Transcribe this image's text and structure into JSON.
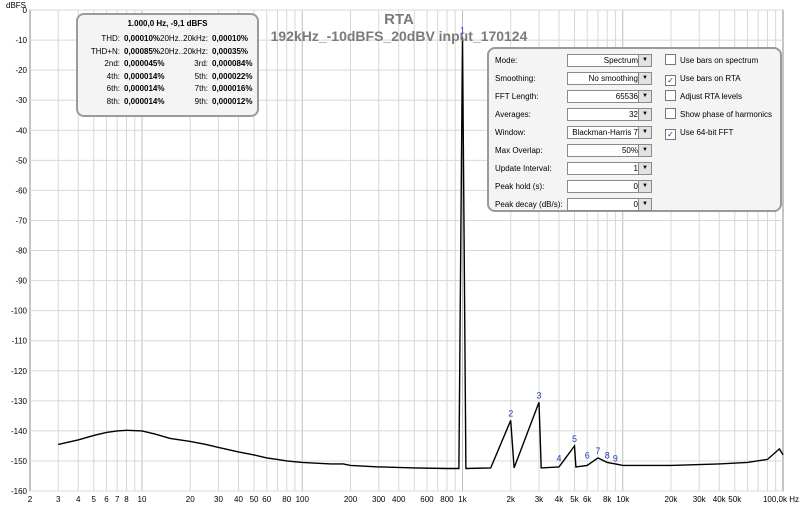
{
  "chart_data": {
    "type": "line",
    "title": "RTA",
    "subtitle": "192kHz_-10dBFS_20dBV input_170124",
    "ylabel": "dBFS",
    "x_unit": "Hz",
    "x_scale": "log",
    "xlim": [
      2,
      100000
    ],
    "ylim": [
      -160,
      0
    ],
    "grid": true,
    "y_ticks": [
      0,
      -10,
      -20,
      -30,
      -40,
      -50,
      -60,
      -70,
      -80,
      -90,
      -100,
      -110,
      -120,
      -130,
      -140,
      -150,
      -160
    ],
    "x_ticks": [
      {
        "v": 2,
        "label": "2"
      },
      {
        "v": 3,
        "label": "3"
      },
      {
        "v": 4,
        "label": "4"
      },
      {
        "v": 5,
        "label": "5"
      },
      {
        "v": 6,
        "label": "6"
      },
      {
        "v": 7,
        "label": "7"
      },
      {
        "v": 8,
        "label": "8"
      },
      {
        "v": 10,
        "label": "10"
      },
      {
        "v": 20,
        "label": "20"
      },
      {
        "v": 30,
        "label": "30"
      },
      {
        "v": 40,
        "label": "40"
      },
      {
        "v": 50,
        "label": "50"
      },
      {
        "v": 60,
        "label": "60"
      },
      {
        "v": 80,
        "label": "80"
      },
      {
        "v": 100,
        "label": "100"
      },
      {
        "v": 200,
        "label": "200"
      },
      {
        "v": 300,
        "label": "300"
      },
      {
        "v": 400,
        "label": "400"
      },
      {
        "v": 600,
        "label": "600"
      },
      {
        "v": 800,
        "label": "800"
      },
      {
        "v": 1000,
        "label": "1k"
      },
      {
        "v": 2000,
        "label": "2k"
      },
      {
        "v": 3000,
        "label": "3k"
      },
      {
        "v": 4000,
        "label": "4k"
      },
      {
        "v": 5000,
        "label": "5k"
      },
      {
        "v": 6000,
        "label": "6k"
      },
      {
        "v": 8000,
        "label": "8k"
      },
      {
        "v": 10000,
        "label": "10k"
      },
      {
        "v": 20000,
        "label": "20k"
      },
      {
        "v": 30000,
        "label": "30k"
      },
      {
        "v": 40000,
        "label": "40k"
      },
      {
        "v": 50000,
        "label": "50k"
      },
      {
        "v": 100000,
        "label": "100,0k Hz"
      }
    ],
    "series": [
      {
        "color": "#000000",
        "points": [
          [
            3,
            -144.5
          ],
          [
            4,
            -143
          ],
          [
            5,
            -141.5
          ],
          [
            6,
            -140.5
          ],
          [
            7,
            -140
          ],
          [
            8,
            -139.8
          ],
          [
            10,
            -140
          ],
          [
            12,
            -141
          ],
          [
            15,
            -142.5
          ],
          [
            20,
            -143.5
          ],
          [
            25,
            -144.5
          ],
          [
            30,
            -145.5
          ],
          [
            40,
            -147
          ],
          [
            50,
            -148
          ],
          [
            60,
            -149
          ],
          [
            70,
            -149.5
          ],
          [
            80,
            -150
          ],
          [
            100,
            -150.5
          ],
          [
            150,
            -151
          ],
          [
            180,
            -151
          ],
          [
            200,
            -151.5
          ],
          [
            300,
            -152
          ],
          [
            500,
            -152.3
          ],
          [
            800,
            -152.5
          ],
          [
            950,
            -152.5
          ],
          [
            1000,
            -9.1
          ],
          [
            1050,
            -152.5
          ],
          [
            1500,
            -152.3
          ],
          [
            2000,
            -136.5
          ],
          [
            2100,
            -152.3
          ],
          [
            3000,
            -130.5
          ],
          [
            3100,
            -152.3
          ],
          [
            4000,
            -152
          ],
          [
            5000,
            -145
          ],
          [
            5100,
            -152
          ],
          [
            6000,
            -151.5
          ],
          [
            7000,
            -149
          ],
          [
            8000,
            -150.5
          ],
          [
            9000,
            -151
          ],
          [
            10000,
            -151.5
          ],
          [
            20000,
            -151.5
          ],
          [
            40000,
            -151
          ],
          [
            60000,
            -150.5
          ],
          [
            80000,
            -149.5
          ],
          [
            95000,
            -146
          ],
          [
            100000,
            -148
          ]
        ]
      }
    ],
    "annotations": [
      {
        "label": "1",
        "x": 1000,
        "y": -9.1
      },
      {
        "label": "2",
        "x": 2000,
        "y": -136.5
      },
      {
        "label": "3",
        "x": 3000,
        "y": -130.5
      },
      {
        "label": "4",
        "x": 4000,
        "y": -151.5
      },
      {
        "label": "5",
        "x": 5000,
        "y": -145
      },
      {
        "label": "6",
        "x": 6000,
        "y": -150.5
      },
      {
        "label": "7",
        "x": 7000,
        "y": -149
      },
      {
        "label": "8",
        "x": 8000,
        "y": -150.5
      },
      {
        "label": "9",
        "x": 9000,
        "y": -151.5
      }
    ]
  },
  "distortion": {
    "header": "1.000,0 Hz, -9,1 dBFS",
    "rows": [
      {
        "l1": "THD:",
        "v1": "0,00010%",
        "l2": "20Hz..20kHz:",
        "v2": "0,00010%"
      },
      {
        "l1": "THD+N:",
        "v1": "0,00085%",
        "l2": "20Hz..20kHz:",
        "v2": "0,00035%"
      },
      {
        "l1": "2nd:",
        "v1": "0,000045%",
        "l2": "3rd:",
        "v2": "0,000084%"
      },
      {
        "l1": "4th:",
        "v1": "0,000014%",
        "l2": "5th:",
        "v2": "0,000022%"
      },
      {
        "l1": "6th:",
        "v1": "0,000014%",
        "l2": "7th:",
        "v2": "0,000016%"
      },
      {
        "l1": "8th:",
        "v1": "0,000014%",
        "l2": "9th:",
        "v2": "0,000012%"
      }
    ]
  },
  "controls": {
    "rows": [
      {
        "label": "Mode:",
        "value": "Spectrum"
      },
      {
        "label": "Smoothing:",
        "value": "No smoothing"
      },
      {
        "label": "FFT Length:",
        "value": "65536"
      },
      {
        "label": "Averages:",
        "value": "32"
      },
      {
        "label": "Window:",
        "value": "Blackman-Harris 7"
      },
      {
        "label": "Max Overlap:",
        "value": "50%"
      },
      {
        "label": "Update Interval:",
        "value": "1"
      },
      {
        "label": "Peak hold (s):",
        "value": "0"
      },
      {
        "label": "Peak decay (dB/s):",
        "value": "0"
      }
    ],
    "checkboxes": [
      {
        "label": "Use bars on spectrum",
        "checked": false
      },
      {
        "label": "Use bars on RTA",
        "checked": true
      },
      {
        "label": "Adjust RTA levels",
        "checked": false
      },
      {
        "label": "Show phase of harmonics",
        "checked": false
      },
      {
        "label": "Use 64-bit FFT",
        "checked": true
      }
    ]
  },
  "colors": {
    "trace": "#000000",
    "peak_label": "#1f3fbf",
    "grid": "#d8d8d8",
    "title": "#7a7a7a"
  },
  "icons": {
    "dropdown": "chevron-down-icon",
    "check": "checkmark-icon"
  }
}
